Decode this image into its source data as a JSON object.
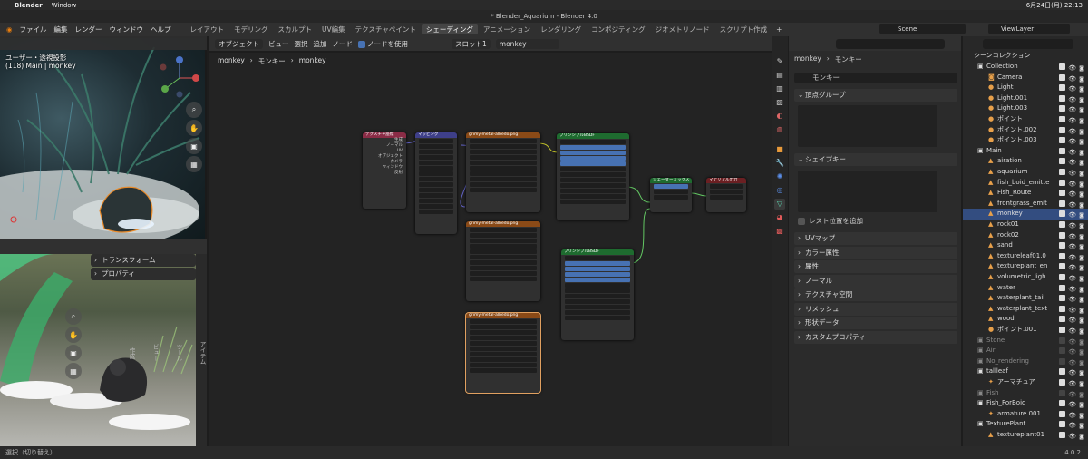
{
  "mac": {
    "app": "Blender",
    "menu": "Window",
    "clock": "6月24日(月) 22:13"
  },
  "window_title": "* Blender_Aquarium - Blender 4.0",
  "menus": [
    "ファイル",
    "編集",
    "レンダー",
    "ウィンドウ",
    "ヘルプ"
  ],
  "workspaces": [
    "レイアウト",
    "モデリング",
    "スカルプト",
    "UV編集",
    "テクスチャペイント",
    "シェーディング",
    "アニメーション",
    "レンダリング",
    "コンポジティング",
    "ジオメトリノード",
    "スクリプト作成"
  ],
  "active_workspace": "シェーディング",
  "scene": "Scene",
  "view_layer": "ViewLayer",
  "viewport1": {
    "line1": "ユーザー・透視投影",
    "line2": "(118) Main | monkey"
  },
  "viewport2": {
    "panels": [
      "トランスフォーム",
      "プロパティ"
    ],
    "tabs": [
      "アイテム",
      "ツール",
      "ビュー",
      "作成"
    ]
  },
  "node_editor": {
    "mode": "オブジェクト",
    "menus": [
      "ビュー",
      "選択",
      "追加",
      "ノード"
    ],
    "use_nodes": "ノードを使用",
    "slot": "スロット1",
    "material": "monkey",
    "breadcrumb": [
      "monkey",
      "モンキー",
      "monkey"
    ],
    "nodes": {
      "texcoord": "テクスチャ座標",
      "mapping": "マッピング",
      "img1": "grimy-metal-albedo.png",
      "img2": "grimy-metal-albedo.png",
      "img3": "grimy-metal-albedo.png",
      "bsdf1": "プリンシプルBSDF",
      "bsdf2": "プリンシプルBSDF",
      "mix": "シェーダーミックス",
      "output": "マテリアル出力"
    }
  },
  "properties": {
    "breadcrumb": [
      "monkey",
      "モンキー"
    ],
    "mesh_name": "モンキー",
    "vertex_groups": "頂点グループ",
    "shape_keys": "シェイプキー",
    "add_rest": "レスト位置を追加",
    "sections": [
      "UVマップ",
      "カラー属性",
      "属性",
      "ノーマル",
      "テクスチャ空間",
      "リメッシュ",
      "形状データ",
      "カスタムプロパティ"
    ]
  },
  "outliner": {
    "title": "シーンコレクション",
    "rows": [
      {
        "name": "Collection",
        "indent": 1,
        "type": "collection"
      },
      {
        "name": "Camera",
        "indent": 2,
        "type": "camera"
      },
      {
        "name": "Light",
        "indent": 2,
        "type": "light"
      },
      {
        "name": "Light.001",
        "indent": 2,
        "type": "light"
      },
      {
        "name": "Light.003",
        "indent": 2,
        "type": "light"
      },
      {
        "name": "ポイント",
        "indent": 2,
        "type": "light"
      },
      {
        "name": "ポイント.002",
        "indent": 2,
        "type": "light"
      },
      {
        "name": "ポイント.003",
        "indent": 2,
        "type": "light"
      },
      {
        "name": "Main",
        "indent": 1,
        "type": "collection"
      },
      {
        "name": "airation",
        "indent": 2,
        "type": "object"
      },
      {
        "name": "aquarium",
        "indent": 2,
        "type": "object"
      },
      {
        "name": "fish_boid_emitte",
        "indent": 2,
        "type": "object"
      },
      {
        "name": "Fish_Route",
        "indent": 2,
        "type": "object"
      },
      {
        "name": "frontgrass_emit",
        "indent": 2,
        "type": "object"
      },
      {
        "name": "monkey",
        "indent": 2,
        "type": "object",
        "selected": true
      },
      {
        "name": "rock01",
        "indent": 2,
        "type": "object"
      },
      {
        "name": "rock02",
        "indent": 2,
        "type": "object"
      },
      {
        "name": "sand",
        "indent": 2,
        "type": "object"
      },
      {
        "name": "textureleaf01.0",
        "indent": 2,
        "type": "object"
      },
      {
        "name": "textureplant_en",
        "indent": 2,
        "type": "object"
      },
      {
        "name": "volumetric_ligh",
        "indent": 2,
        "type": "object"
      },
      {
        "name": "water",
        "indent": 2,
        "type": "object"
      },
      {
        "name": "waterplant_tail",
        "indent": 2,
        "type": "object"
      },
      {
        "name": "waterplant_text",
        "indent": 2,
        "type": "object"
      },
      {
        "name": "wood",
        "indent": 2,
        "type": "object"
      },
      {
        "name": "ポイント.001",
        "indent": 2,
        "type": "light"
      },
      {
        "name": "Stone",
        "indent": 1,
        "type": "collection",
        "dim": true
      },
      {
        "name": "Air",
        "indent": 1,
        "type": "collection",
        "dim": true
      },
      {
        "name": "No_rendering",
        "indent": 1,
        "type": "collection",
        "dim": true
      },
      {
        "name": "tallleaf",
        "indent": 1,
        "type": "collection"
      },
      {
        "name": "アーマチュア",
        "indent": 2,
        "type": "armature"
      },
      {
        "name": "Fish",
        "indent": 1,
        "type": "collection",
        "dim": true
      },
      {
        "name": "Fish_ForBoid",
        "indent": 1,
        "type": "collection"
      },
      {
        "name": "armature.001",
        "indent": 2,
        "type": "armature"
      },
      {
        "name": "TexturePlant",
        "indent": 1,
        "type": "collection"
      },
      {
        "name": "textureplant01",
        "indent": 2,
        "type": "object"
      }
    ]
  },
  "status": {
    "left": "選択（切り替え）",
    "version": "4.0.2"
  },
  "colors": {
    "accent": "#4772b3",
    "selected_row": "#334d80",
    "texture_node": "#8a4a17",
    "shader_node": "#1e6b2f",
    "vector_node": "#3e3f89",
    "input_node": "#8a2c46",
    "output_node": "#6b1f22",
    "link_yellow": "#c7c729",
    "link_green": "#63c763",
    "link_purple": "#6363c7"
  }
}
